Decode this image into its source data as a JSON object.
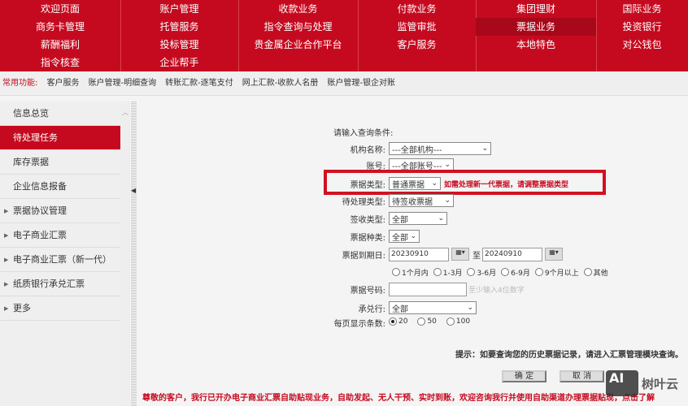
{
  "topnav": {
    "rows": [
      [
        "欢迎页面",
        "账户管理",
        "收款业务",
        "付款业务",
        "集团理财",
        "国际业务"
      ],
      [
        "商务卡管理",
        "托管服务",
        "指令查询与处理",
        "监管审批",
        "票据业务",
        "投资银行"
      ],
      [
        "薪酬福利",
        "投标管理",
        "贵金属企业合作平台",
        "客户服务",
        "本地特色",
        "对公钱包"
      ],
      [
        "指令核查",
        "企业帮手"
      ]
    ],
    "active": "票据业务"
  },
  "common": {
    "label": "常用功能:",
    "items": [
      "客户服务",
      "账户管理-明细查询",
      "转账汇款-逐笔支付",
      "网上汇款-收款人名册",
      "账户管理-银企对账"
    ]
  },
  "sidebar": {
    "items": [
      {
        "label": "信息总览",
        "arrow": false
      },
      {
        "label": "待处理任务",
        "arrow": false,
        "active": true
      },
      {
        "label": "库存票据",
        "arrow": false
      },
      {
        "label": "企业信息报备",
        "arrow": false
      },
      {
        "label": "票据协议管理",
        "arrow": true
      },
      {
        "label": "电子商业汇票",
        "arrow": true
      },
      {
        "label": "电子商业汇票（新一代）",
        "arrow": true
      },
      {
        "label": "纸质银行承兑汇票",
        "arrow": true
      },
      {
        "label": "更多",
        "arrow": true
      }
    ]
  },
  "form": {
    "title": "请输入查询条件:",
    "org": {
      "label": "机构名称:",
      "value": "---全部机构---"
    },
    "account": {
      "label": "账号:",
      "value": "---全部账号---"
    },
    "bill_type": {
      "label": "票据类型:",
      "value": "普通票据",
      "hint": "如需处理新一代票据，请调整票据类型"
    },
    "pending_type": {
      "label": "待处理类型:",
      "value": "待签收票据"
    },
    "sign_type": {
      "label": "签收类型:",
      "value": "全部"
    },
    "bill_kind": {
      "label": "票据种类:",
      "value": "全部"
    },
    "due": {
      "label": "票据到期日:",
      "from": "20230910",
      "to_label": "至",
      "to": "20240910",
      "ranges": [
        "1个月内",
        "1-3月",
        "3-6月",
        "6-9月",
        "9个月以上",
        "其他"
      ]
    },
    "bill_no": {
      "label": "票据号码:",
      "value": "",
      "placeholder": "至少输入4位数字"
    },
    "acceptor": {
      "label": "承兑行:",
      "value": "全部"
    },
    "page_size": {
      "label": "每页显示条数:",
      "options": [
        "20",
        "50",
        "100"
      ],
      "selected": "20"
    },
    "tip": "提示：如要查询您的历史票据记录，请进入汇票管理模块查询。",
    "ok": "确 定",
    "cancel": "取 消"
  },
  "notice": "尊敬的客户，我行已开办电子商业汇票自助贴现业务，自助发起、无人干预、实时到账，欢迎咨询我行并使用自助渠道办理票据贴现，点击了解",
  "watermark": {
    "logo": "AI",
    "text": "树叶云"
  }
}
